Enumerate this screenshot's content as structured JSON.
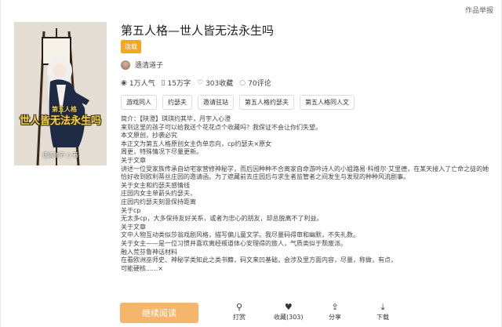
{
  "header": {
    "report_label": "作品举报"
  },
  "book": {
    "title": "第五人格—世人皆无法永生吗",
    "status_badge": "连载",
    "author": "遗清道子",
    "cover": {
      "top_text": "第五人格",
      "title_text": "世人皆无法永生吗",
      "sub_text": "遗清道子 ○ 著"
    }
  },
  "stats": {
    "popularity": "1万人气",
    "words": "15万字",
    "favorites": "303收藏",
    "comments": "70评论"
  },
  "tags": [
    "游戏同人",
    "约瑟夫",
    "邀请驻站",
    "第五人格约瑟夫",
    "第五人格同人文"
  ],
  "description": [
    "简介：【陕澄】琪琪约其毕，月宇入心澄",
    "来到这里的孩子可以给我送个花花点个收藏吗？我保证不会让你们失望。",
    "本文原创，抄袭必究",
    "本正文为第五人格原创女主伪单恋向，cp约瑟夫×原女",
    "周更，特殊情况下尽量更新。",
    "关于文章",
    "讲述一位受家族传承自幼宅家营修神秘学，而后因种种不合离家自命游吟诗人的小姐路易·科维尔·艾里德，在某天接入了亡命之徒的她恰好收到欧利蒂丝庄园的邀请函。为了遮藏前去庄园后与求生者监管者之间发生与发现的种种风流剧事。",
    "关于女主和约瑟夫感情线",
    "庄园内女主单箭头约瑟夫，",
    "庄园内约瑟夫刻意保持距离",
    "关于cp",
    "无太多cp，大多保持友好关系，或者为忠心的朋友，却总脱离不了利益。",
    "关于文章",
    "文中人物互动类似莎翁戏剧风格，描写偏儿童文学。我尽量码得审和幽默，不失礼数。",
    "关于女主——是一位习惯并喜欢离经叛道体心安理得的旅人，气质类似于颓废派。",
    "融入荒芬鲁神话材料",
    "在看欧洲巫师史、神秘学类知此之类书籍，码文来凹基础，会涉及里方面内容，尽量，称做，有点，",
    "可能硬核......×"
  ],
  "actions": {
    "read": "继续阅读",
    "tip": "打赏",
    "favorite": "收藏(303)",
    "share": "分享",
    "download": "下载"
  }
}
